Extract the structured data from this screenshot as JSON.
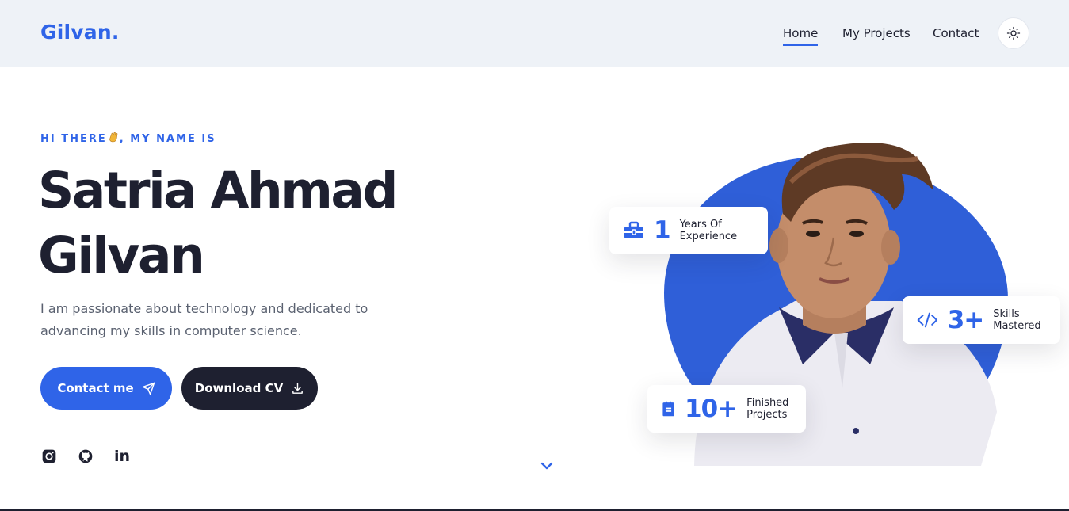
{
  "header": {
    "logo": "Gilvan.",
    "nav": [
      {
        "label": "Home",
        "active": true
      },
      {
        "label": "My Projects"
      },
      {
        "label": "Contact"
      }
    ],
    "theme_toggle_icon": "sun-icon"
  },
  "hero": {
    "greeting_prefix": "HI THERE",
    "greeting_suffix": ", MY NAME IS",
    "name_line1": "Satria Ahmad",
    "name_line2": "Gilvan",
    "description": "I am passionate about technology and dedicated to advancing my skills in computer science.",
    "buttons": {
      "contact": "Contact me",
      "download_cv": "Download CV"
    },
    "social_icons": [
      "instagram-icon",
      "github-icon",
      "linkedin-icon"
    ],
    "social_text": {
      "linkedin": "in"
    }
  },
  "stats": {
    "years": {
      "value": "1",
      "label": "Years Of Experience",
      "icon": "briefcase-icon"
    },
    "skills": {
      "value": "3+",
      "label": "Skills Mastered",
      "icon": "code-icon"
    },
    "projects": {
      "value": "10+",
      "label": "Finished Projects",
      "icon": "document-icon"
    }
  },
  "colors": {
    "accent": "#2f64e8",
    "dark": "#1e2030",
    "header_bg": "#eef2f7",
    "blob": "#2f5fd8"
  }
}
